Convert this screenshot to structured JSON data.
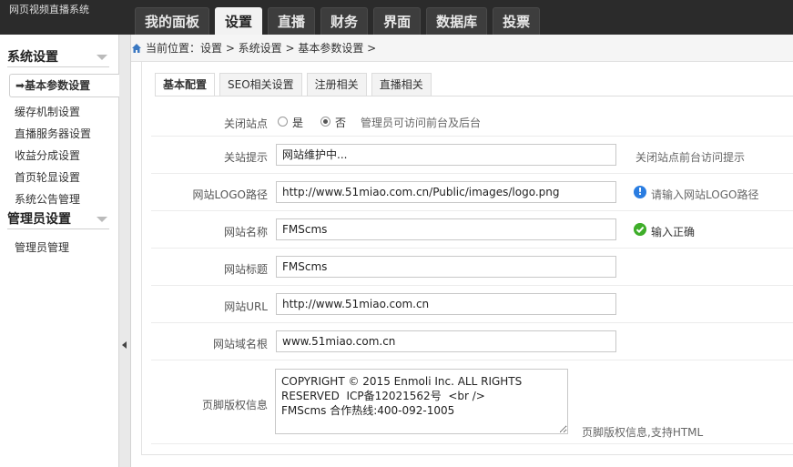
{
  "header": {
    "logo_text": "网页视频直播系统",
    "nav": [
      "我的面板",
      "设置",
      "直播",
      "财务",
      "界面",
      "数据库",
      "投票"
    ],
    "active_nav": "设置"
  },
  "sidebar": {
    "group1": "系统设置",
    "items": [
      "缓存机制设置",
      "直播服务器设置",
      "收益分成设置",
      "首页轮显设置",
      "系统公告管理"
    ],
    "active_item": "基本参数设置",
    "active_mark": "➡",
    "group2": "管理员设置",
    "group2_items": [
      "管理员管理"
    ]
  },
  "breadcrumb": {
    "text": "当前位置：设置 > 系统设置 > 基本参数设置 >"
  },
  "tabs": [
    "基本配置",
    "SEO相关设置",
    "注册相关",
    "直播相关"
  ],
  "form": {
    "close_site": {
      "label": "关闭站点",
      "opt_yes": "是",
      "opt_no": "否",
      "selected": "否",
      "note": "管理员可访问前台及后台"
    },
    "close_msg": {
      "label": "关站提示",
      "value": "网站维护中...",
      "hint": "关闭站点前台访问提示"
    },
    "logo_path": {
      "label": "网站LOGO路径",
      "value": "http://www.51miao.com.cn/Public/images/logo.png",
      "hint": "请输入网站LOGO路径"
    },
    "site_name": {
      "label": "网站名称",
      "value": "FMScms",
      "hint": "输入正确"
    },
    "site_title": {
      "label": "网站标题",
      "value": "FMScms"
    },
    "site_url": {
      "label": "网站URL",
      "value": "http://www.51miao.com.cn"
    },
    "site_domain": {
      "label": "网站域名根",
      "value": "www.51miao.com.cn"
    },
    "footer": {
      "label": "页脚版权信息",
      "value": "COPYRIGHT © 2015 Enmoli Inc. ALL RIGHTS RESERVED  ICP备12021562号  <br />\nFMScms 合作热线:400-092-1005",
      "hint": "页脚版权信息,支持HTML"
    }
  },
  "colors": {
    "topbar": "#2b2b2b",
    "info": "#2a7de1",
    "ok": "#3fae2a"
  }
}
